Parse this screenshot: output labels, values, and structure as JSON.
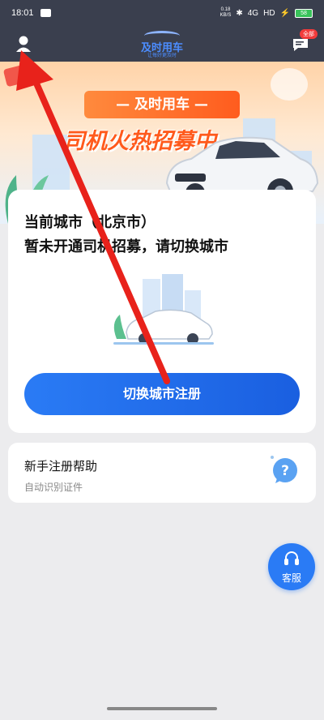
{
  "status_bar": {
    "time": "18:01",
    "net_speed_value": "0.18",
    "net_speed_unit": "KB/S",
    "network": "4G",
    "hd": "HD",
    "battery": "58"
  },
  "header": {
    "logo_title": "及时用车",
    "logo_subtitle": "让每好更及时",
    "message_badge": "全部"
  },
  "banner": {
    "ribbon": "— 及时用车 —",
    "headline": "司机火热招募中"
  },
  "city_card": {
    "line1": "当前城市（北京市）",
    "line2": "暂未开通司机招募，请切换城市",
    "switch_button": "切换城市注册"
  },
  "help_card": {
    "title": "新手注册帮助",
    "subtitle": "自动识别证件"
  },
  "service": {
    "label": "客服"
  },
  "colors": {
    "header_bg": "#3a3f4e",
    "primary_blue": "#2a7bf5",
    "banner_orange": "#ff5a1c",
    "annotation_red": "#e8221b"
  }
}
